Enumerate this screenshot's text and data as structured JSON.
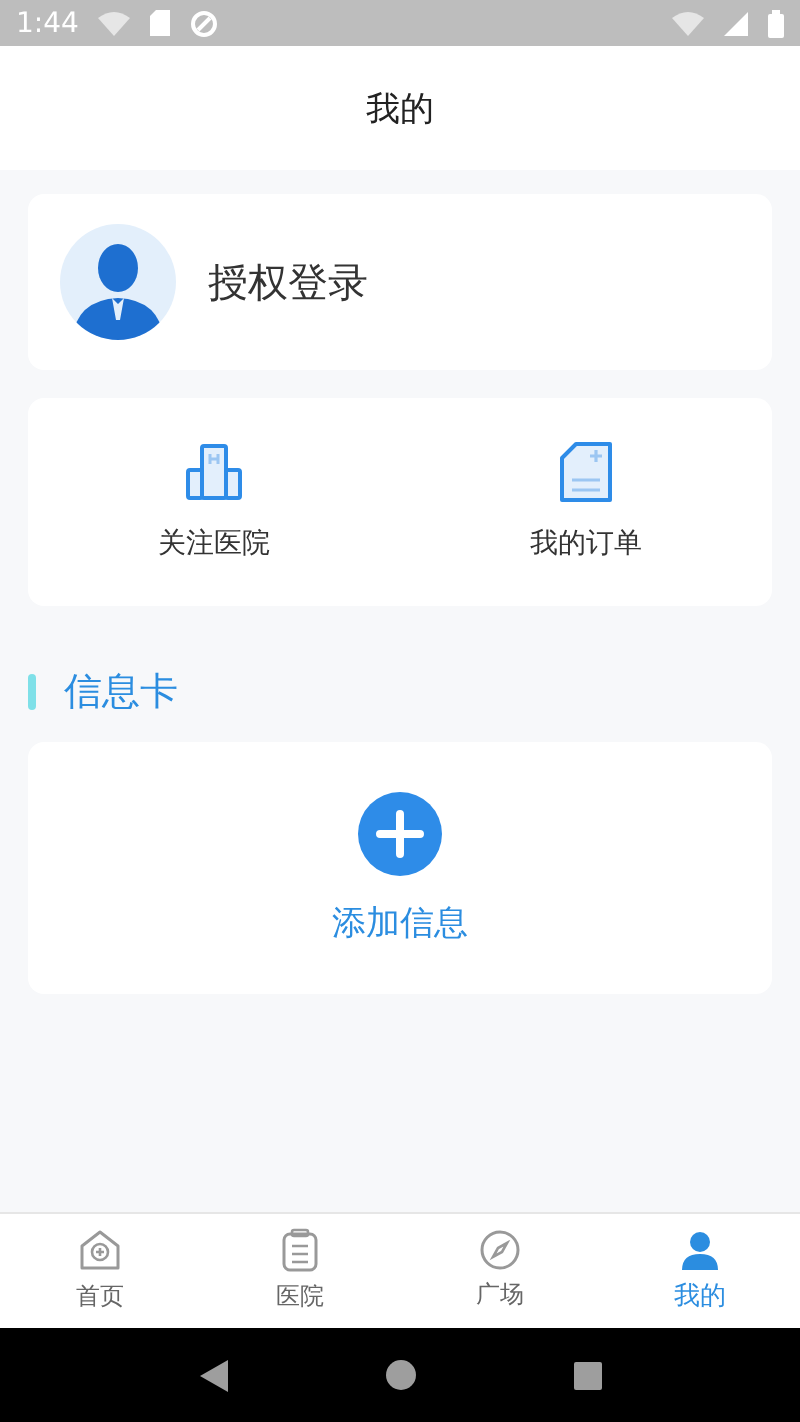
{
  "status_bar": {
    "time": "1:44"
  },
  "header": {
    "title": "我的"
  },
  "login": {
    "label": "授权登录"
  },
  "shortcuts": [
    {
      "kind": "hospital",
      "label": "关注医院"
    },
    {
      "kind": "order",
      "label": "我的订单"
    }
  ],
  "info_section": {
    "title": "信息卡",
    "add_label": "添加信息"
  },
  "tabs": [
    {
      "kind": "home",
      "label": "首页",
      "selected": false
    },
    {
      "kind": "hospital",
      "label": "医院",
      "selected": false
    },
    {
      "kind": "square",
      "label": "广场",
      "selected": false
    },
    {
      "kind": "me",
      "label": "我的",
      "selected": true
    }
  ]
}
